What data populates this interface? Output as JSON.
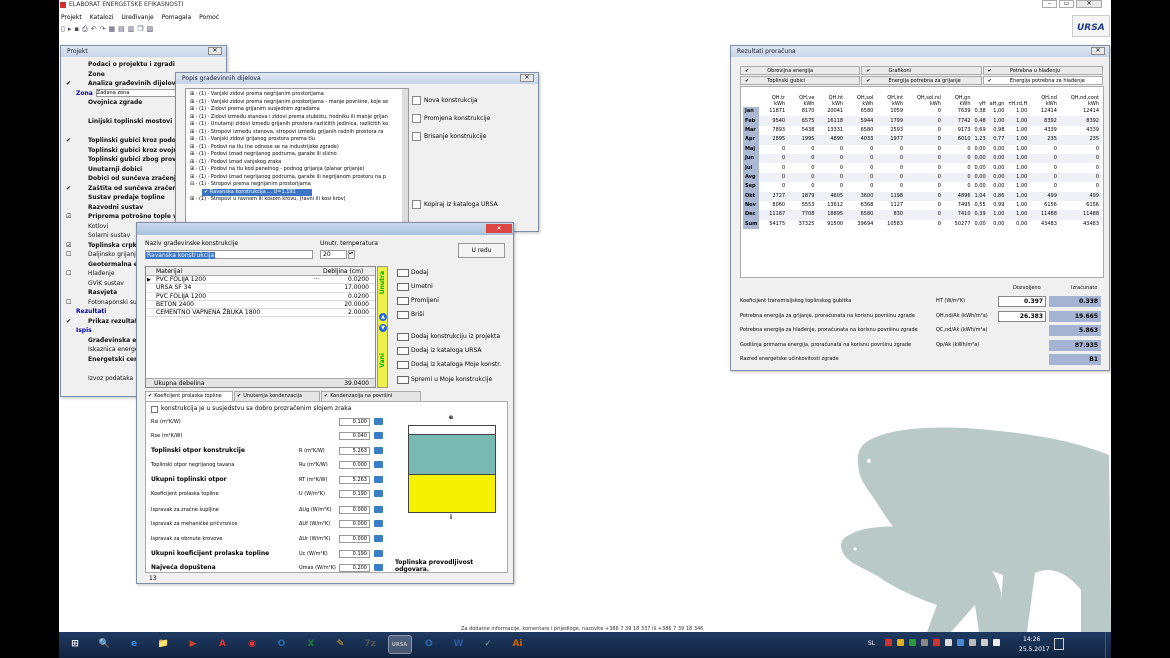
{
  "app": {
    "title": "ELABORAT ENERGETSKE EFIKASNOSTI",
    "menu": [
      "Projekt",
      "Katalozi",
      "Uređivanje",
      "Pomagala",
      "Pomoć"
    ],
    "logo": "URSA"
  },
  "projekt": {
    "title": "Projekt",
    "items": [
      {
        "check": "",
        "label": "Podaci o projektu i zgradi",
        "bold": true
      },
      {
        "check": "",
        "label": "Zone",
        "bold": true
      },
      {
        "check": "✔",
        "label": "Analiza građevinih dijelova",
        "bold": true
      },
      {
        "check": "",
        "label": "Zona",
        "bold": true,
        "blue": true
      },
      {
        "check": "",
        "label": "Ovojnica zgrade",
        "bold": true
      },
      {
        "check": "",
        "label": ""
      },
      {
        "check": "",
        "label": "Linijski toplinski mostovi",
        "bold": true
      },
      {
        "check": "",
        "label": ""
      },
      {
        "check": "✔",
        "label": "Toplinski gubici kroz podove",
        "bold": true
      },
      {
        "check": "",
        "label": "Toplinski gubici kroz ovojnicu",
        "bold": true
      },
      {
        "check": "",
        "label": "Toplinski gubici zbog provjetravanja",
        "bold": true
      },
      {
        "check": "",
        "label": "Unutarnji dobici",
        "bold": true
      },
      {
        "check": "",
        "label": "Dobici od sunčeva zračenja",
        "bold": true
      },
      {
        "check": "✔",
        "label": "Zaštita od sunčeva zračenja",
        "bold": true
      },
      {
        "check": "",
        "label": "Sustav predaje topline",
        "bold": true
      },
      {
        "check": "",
        "label": "Razvodni sustav",
        "bold": true
      },
      {
        "check": "☑",
        "label": "Priprema potrošne tople vode",
        "bold": true
      },
      {
        "check": "",
        "label": "Kotlovi",
        "bold": false
      },
      {
        "check": "",
        "label": "Solarni sustav",
        "bold": false
      },
      {
        "check": "☑",
        "label": "Toplinska crpka",
        "bold": true
      },
      {
        "check": "☐",
        "label": "Daljinsko grijanje",
        "bold": false
      },
      {
        "check": "",
        "label": "Geotermalna energija",
        "bold": true
      },
      {
        "check": "☐",
        "label": "Hlađenje",
        "bold": false
      },
      {
        "check": "",
        "label": "GViK sustav",
        "bold": false
      },
      {
        "check": "",
        "label": "Rasvjeta",
        "bold": true
      },
      {
        "check": "☐",
        "label": "Fotonaponski sustav",
        "bold": false
      },
      {
        "check": "",
        "label": "Rezultati",
        "bold": true,
        "blue": true
      },
      {
        "check": "✔",
        "label": "Prikaz rezultata",
        "bold": true
      },
      {
        "check": "",
        "label": "Ispis",
        "bold": true,
        "blue": true
      },
      {
        "check": "",
        "label": "Građevinska energetska bilanca",
        "bold": true
      },
      {
        "check": "",
        "label": "Iskaznica energetskih svojstava",
        "bold": false
      },
      {
        "check": "",
        "label": "Energetski certifikat",
        "bold": true
      },
      {
        "check": "",
        "label": ""
      },
      {
        "check": "",
        "label": "Izvoz podataka",
        "bold": false
      }
    ],
    "zona_value": "Zadana zona"
  },
  "popis": {
    "title": "Popis građevinnih dijelova",
    "items": [
      "⊞ · (1) · Vanjski zidovi prema negrijanim prostorijama",
      "⊞ · (1) · Vanjski zidovi prema negrijanim prostorijama - manje površine, koje se",
      "⊞ · (1) · Zidovi prema grijanim susjednim zgradama",
      "⊞ · (1) · Zidovi između stanova i zidovi prema stubištu, hodniku ili manje grijan",
      "⊞ · (1) · Unutarnji zidovi između grijanih prostora različitih jedinica, različitih ko",
      "⊞ · (1) · Stropovi između stanova, stropovi između grijanih radnih prostora ra",
      "⊞ · (1) · Vanjski zidovi grijanog prostora prema tlu",
      "⊞ · (1) · Podovi na tlu (ne odnose se na industrijske zgrade)",
      "⊞ · (1) · Podovi iznad negrijanog podruma, garaže ili slično",
      "⊞ · (1) · Podovi iznad vanjskog zraka",
      "⊞ · (1) · Podovi na tlu kod panelnog - podnog grijanja (planar grijanje)",
      "⊞ · (1) · Podovi iznad negrijanog podruma, garaže ili negrijanom prostoru na p",
      "⊟ · (1) · Stropovi prema negrijanim prostorijama",
      "✔ Ravanska konstrukcija ... U=1.191",
      "⊞ · (1) · Stropovi u ravnom ili kosom krovu, (ravni ili kosi krov)"
    ],
    "buttons": [
      "Nova konstrukcija",
      "Promjena konstrukcije",
      "Brisanje konstrukcije",
      "Kopiraj iz kataloga URSA"
    ]
  },
  "konstrukcija": {
    "naziv_label": "Naziv građevinske konstrukcije",
    "naziv_value": "Ravanska konstrukcija",
    "temp_label": "Unutr. temperatura",
    "temp_value": "20",
    "ok_label": "U redu",
    "col_material": "Materijal",
    "col_debljina": "Debljina (cm)",
    "layers": [
      {
        "name": "PVC FOLIJA 1200",
        "d": "0.0200",
        "extra": "···"
      },
      {
        "name": "URSA SF 34",
        "d": "17.0000",
        "extra": ""
      },
      {
        "name": "PVC FOLIJA 1200",
        "d": "0.0200",
        "extra": ""
      },
      {
        "name": "BETON 2400",
        "d": "20.0000",
        "extra": ""
      },
      {
        "name": "CEMENTNO VAPNENA ŽBUKA 1800",
        "d": "2.0000",
        "extra": ""
      }
    ],
    "ukupna_label": "Ukupna debelina",
    "ukupna_value": "39.0400",
    "side_top": "Unutra",
    "side_bottom": "Vani",
    "actions": [
      "Dodaj",
      "Umetni",
      "Promijeni",
      "Briši",
      "Dodaj konstrukciju iz projekta",
      "Dodaj iz kataloga URSA",
      "Dodaj iz kataloga Moje konstr.",
      "Spremi u Moje konstrukcije"
    ],
    "tabs": [
      "Koeficijent prolaska topline",
      "Unutarnja kondenzacija",
      "Kondenzacija na površini"
    ],
    "zrak_check": "konstrukcija je u susjedstvu sa dobro prozračenim slojem zraka",
    "rows": [
      {
        "label": "Rsi (m²K/W)",
        "sym": "",
        "value": "0.100",
        "bold": false
      },
      {
        "label": "Rse (m²K/W)",
        "sym": "",
        "value": "0.040",
        "bold": false
      },
      {
        "label": "Toplinski otpor konstrukcije",
        "sym": "R (m²K/W)",
        "value": "5.263",
        "bold": true
      },
      {
        "label": "Toplinski otpor negrijanog tavana",
        "sym": "Ru (m²K/W)",
        "value": "0.000",
        "bold": false
      },
      {
        "label": "Ukupni toplinski otpor",
        "sym": "RT (m²K/W)",
        "value": "5.263",
        "bold": true
      },
      {
        "label": "Koeficijent prolaska topline",
        "sym": "U (W/m²K)",
        "value": "0.190",
        "bold": false
      },
      {
        "label": "Ispravak za zračne šupljine",
        "sym": "ΔUg (W/m²K)",
        "value": "0.000",
        "bold": false
      },
      {
        "label": "Ispravak za mehaničke pričvrsnice",
        "sym": "ΔUf (W/m²K)",
        "value": "0.000",
        "bold": false
      },
      {
        "label": "Ispravak za obrnute krovove",
        "sym": "ΔUr (W/m²K)",
        "value": "0.000",
        "bold": false
      },
      {
        "label": "Ukupni koeficijent prolaska topline",
        "sym": "Uc (W/m²K)",
        "value": "0.190",
        "bold": true
      },
      {
        "label": "Najveća dopuštena",
        "sym": "Umax (W/m²K)",
        "value": "0.200",
        "bold": true
      }
    ],
    "diagram_top": "e",
    "diagram_bottom": "i",
    "status": "Toplinska provodljivost odgovara.",
    "statusbar": "13"
  },
  "rezultati": {
    "title": "Rezultati proračuna",
    "tabs_row1": [
      "Obrovijna energija",
      "Grafikoni",
      "Potrebna u hlađenju"
    ],
    "tabs_row2": [
      "Toplinski gubici",
      "Energija potrebna za grijanje",
      "Energija potrebna za hlađenje"
    ],
    "headers": [
      "",
      "QH,tr kWh",
      "QH,ve kWh",
      "QH,ht kWh",
      "QH,sol kWh",
      "QH,int kWh",
      "QH,sol,rsl kWh",
      "QH,gn kWh",
      "γH",
      "aH,gn",
      "τH,rd,H",
      "QH,nd kWh",
      "QH,nd,cont kWh"
    ],
    "rows": [
      [
        "Jan",
        "11871",
        "8170",
        "20041",
        "6580",
        "1059",
        "0",
        "7639",
        "0,38",
        "1,00",
        "1,00",
        "12414",
        "12414"
      ],
      [
        "Feb",
        "9540",
        "6575",
        "16118",
        "5944",
        "1799",
        "0",
        "7742",
        "0,48",
        "1,00",
        "1,00",
        "8392",
        "8392"
      ],
      [
        "Mar",
        "7893",
        "5438",
        "13331",
        "6580",
        "2593",
        "0",
        "9173",
        "0,69",
        "0,98",
        "1,00",
        "4339",
        "4339"
      ],
      [
        "Apr",
        "2895",
        "1995",
        "4890",
        "4033",
        "1977",
        "0",
        "6010",
        "1,23",
        "0,77",
        "1,00",
        "235",
        "235"
      ],
      [
        "Maj",
        "0",
        "0",
        "0",
        "0",
        "0",
        "0",
        "0",
        "0,00",
        "0,00",
        "1,00",
        "0",
        "0"
      ],
      [
        "Jun",
        "0",
        "0",
        "0",
        "0",
        "0",
        "0",
        "0",
        "0,00",
        "0,00",
        "1,00",
        "0",
        "0"
      ],
      [
        "Jul",
        "0",
        "0",
        "0",
        "0",
        "0",
        "0",
        "0",
        "0,00",
        "0,00",
        "1,00",
        "0",
        "0"
      ],
      [
        "Avg",
        "0",
        "0",
        "0",
        "0",
        "0",
        "0",
        "0",
        "0,00",
        "0,00",
        "1,00",
        "0",
        "0"
      ],
      [
        "Sep",
        "0",
        "0",
        "0",
        "0",
        "0",
        "0",
        "0",
        "0,00",
        "0,00",
        "1,00",
        "0",
        "0"
      ],
      [
        "Okt",
        "2727",
        "1879",
        "4605",
        "3600",
        "1198",
        "0",
        "4896",
        "1,04",
        "0,86",
        "1,00",
        "499",
        "499"
      ],
      [
        "Nov",
        "8060",
        "5553",
        "13612",
        "6368",
        "1127",
        "0",
        "7495",
        "0,55",
        "0,99",
        "1,00",
        "6156",
        "6156"
      ],
      [
        "Dec",
        "11187",
        "7708",
        "18895",
        "6580",
        "830",
        "0",
        "7410",
        "0,39",
        "1,00",
        "1,00",
        "11488",
        "11488"
      ],
      [
        "Sum",
        "54175",
        "37325",
        "91500",
        "39694",
        "10583",
        "0",
        "50277",
        "0,00",
        "0,00",
        "0,00",
        "43483",
        "43483"
      ]
    ],
    "col_dozvoljeno": "Dozvoljeno",
    "col_izracunato": "Izračunato",
    "summary": [
      {
        "label": "Koeficijent transmisijskog toplinskog gubitka",
        "sym": "HT (W/m²K)",
        "allowed": "0.397",
        "value": "0.338"
      },
      {
        "label": "Potrebna energija za grijanje, proračunata na korisnu površinu zgrade",
        "sym": "QH,nd/Ak (kWh/m²a)",
        "allowed": "26.383",
        "value": "19.665"
      },
      {
        "label": "Potrebna energija za hlađenje, proračunata na korisnu površinu zgrade",
        "sym": "QC,nd/Ak (kWh/m²a)",
        "allowed": "",
        "value": "5.863"
      },
      {
        "label": "Godišnja primarna energija, proračunata na korisnu površinu zgrade",
        "sym": "Qp/Ak (kWh/m²a)",
        "allowed": "",
        "value": "87.935"
      },
      {
        "label": "Razred energetske učinkovitosti zgrade",
        "sym": "",
        "allowed": "",
        "value": "B1"
      }
    ]
  },
  "footer": {
    "text": "Za dodatne informacije, komentare i prijedloge, nazovite +386 7 39 18 337 ili +386 7 39 18 346"
  },
  "taskbar": {
    "lang": "SL",
    "time": "14:26",
    "date": "25.5.2017",
    "apps": [
      "⊞",
      "🔍",
      "e",
      "📁",
      "▶",
      "A",
      "◉",
      "O",
      "X",
      "✎",
      "7z",
      "URSA",
      "O",
      "W",
      "✓",
      "Ai"
    ]
  },
  "colors": {
    "accent": "#1f3c88",
    "bear": "#b8c9c7",
    "diagram_top": "#79b8b3",
    "diagram_bottom": "#f4f200",
    "navy": "#00a",
    "highlight": "#3a74c4"
  }
}
